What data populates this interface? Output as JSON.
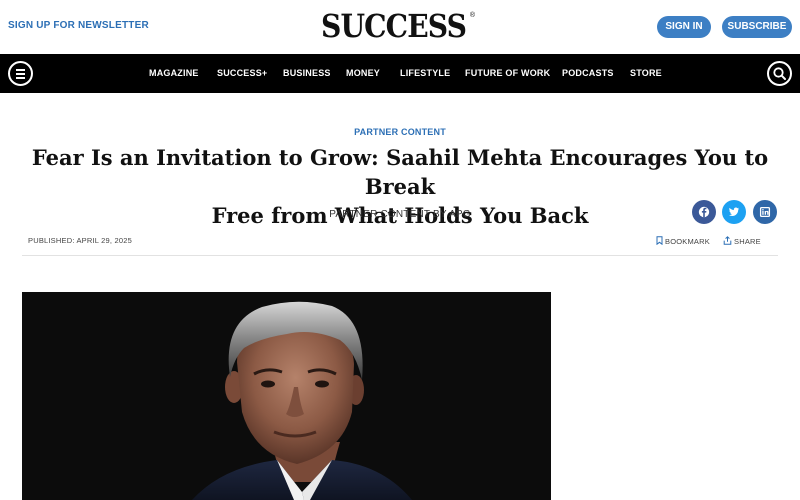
{
  "header": {
    "newsletter_link": "SIGN UP FOR NEWSLETTER",
    "logo_text": "SUCCESS",
    "logo_mark": "®",
    "sign_in": "SIGN IN",
    "subscribe": "SUBSCRIBE"
  },
  "nav": {
    "items": [
      "MAGAZINE",
      "SUCCESS+",
      "BUSINESS",
      "MONEY",
      "LIFESTYLE",
      "FUTURE OF WORK",
      "PODCASTS",
      "STORE"
    ],
    "menu_icon": "hamburger-menu-icon",
    "search_icon": "search-icon"
  },
  "article": {
    "category": "PARTNER CONTENT",
    "title_line1": "Fear Is an Invitation to Grow: Saahil Mehta Encourages You to Break",
    "title_line2": "Free from What Holds You Back",
    "byline": "PARTNER CONTENT BY APG",
    "published": "PUBLISHED: APRIL 29, 2025",
    "bookmark": "BOOKMARK",
    "share": "SHARE"
  },
  "social": [
    {
      "name": "facebook-icon",
      "color": "#3b5998"
    },
    {
      "name": "twitter-icon",
      "color": "#1da1f2"
    },
    {
      "name": "linkedin-icon",
      "color": "#2f67a8"
    }
  ],
  "colors": {
    "accent": "#2c6fb5",
    "button": "#3d7fc4",
    "navbar": "#000000"
  }
}
